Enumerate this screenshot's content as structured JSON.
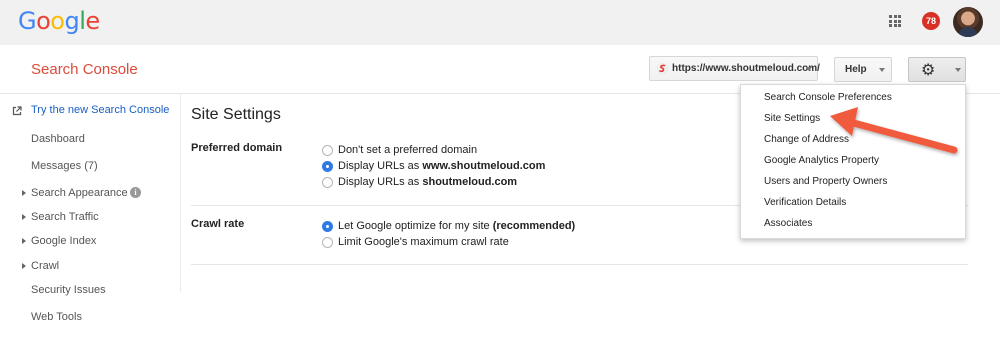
{
  "brand": {
    "logo_letters": [
      {
        "char": "G",
        "color": "#4285f4"
      },
      {
        "char": "o",
        "color": "#ea4335"
      },
      {
        "char": "o",
        "color": "#fbbc05"
      },
      {
        "char": "g",
        "color": "#4285f4"
      },
      {
        "char": "l",
        "color": "#34a853"
      },
      {
        "char": "e",
        "color": "#ea4335"
      }
    ],
    "product": "Search Console"
  },
  "topbar": {
    "apps_icon": "grid-apps-icon",
    "notification_count": "78",
    "avatar_icon": "user-avatar"
  },
  "header": {
    "site_url": "https://www.shoutmeloud.com/",
    "help_label": "Help",
    "settings_icon": "gear-icon"
  },
  "sidebar": {
    "try_new": "Try the new Search Console",
    "items": [
      {
        "label": "Dashboard",
        "expandable": false
      },
      {
        "label": "Messages (7)",
        "expandable": false
      },
      {
        "label": "Search Appearance",
        "expandable": true,
        "info": true
      },
      {
        "label": "Search Traffic",
        "expandable": true
      },
      {
        "label": "Google Index",
        "expandable": true
      },
      {
        "label": "Crawl",
        "expandable": true
      },
      {
        "label": "Security Issues",
        "expandable": false
      },
      {
        "label": "Web Tools",
        "expandable": false
      }
    ],
    "info_glyph": "i"
  },
  "main": {
    "title": "Site Settings",
    "preferred_domain": {
      "label": "Preferred domain",
      "options": [
        {
          "prefix": "Don't set a preferred domain",
          "bold": "",
          "selected": false
        },
        {
          "prefix": "Display URLs as ",
          "bold": "www.shoutmeloud.com",
          "selected": true
        },
        {
          "prefix": "Display URLs as ",
          "bold": "shoutmeloud.com",
          "selected": false
        }
      ]
    },
    "crawl_rate": {
      "label": "Crawl rate",
      "options": [
        {
          "prefix": "Let Google optimize for my site ",
          "bold": "(recommended)",
          "selected": true
        },
        {
          "prefix": "Limit Google's maximum crawl rate",
          "bold": "",
          "selected": false
        }
      ]
    },
    "edge_fragment": "e"
  },
  "settings_menu": {
    "items": [
      "Search Console Preferences",
      "Site Settings",
      "Change of Address",
      "Google Analytics Property",
      "Users and Property Owners",
      "Verification Details",
      "Associates"
    ],
    "highlighted_item": "Site Settings",
    "arrow_color": "#f05a3c"
  }
}
